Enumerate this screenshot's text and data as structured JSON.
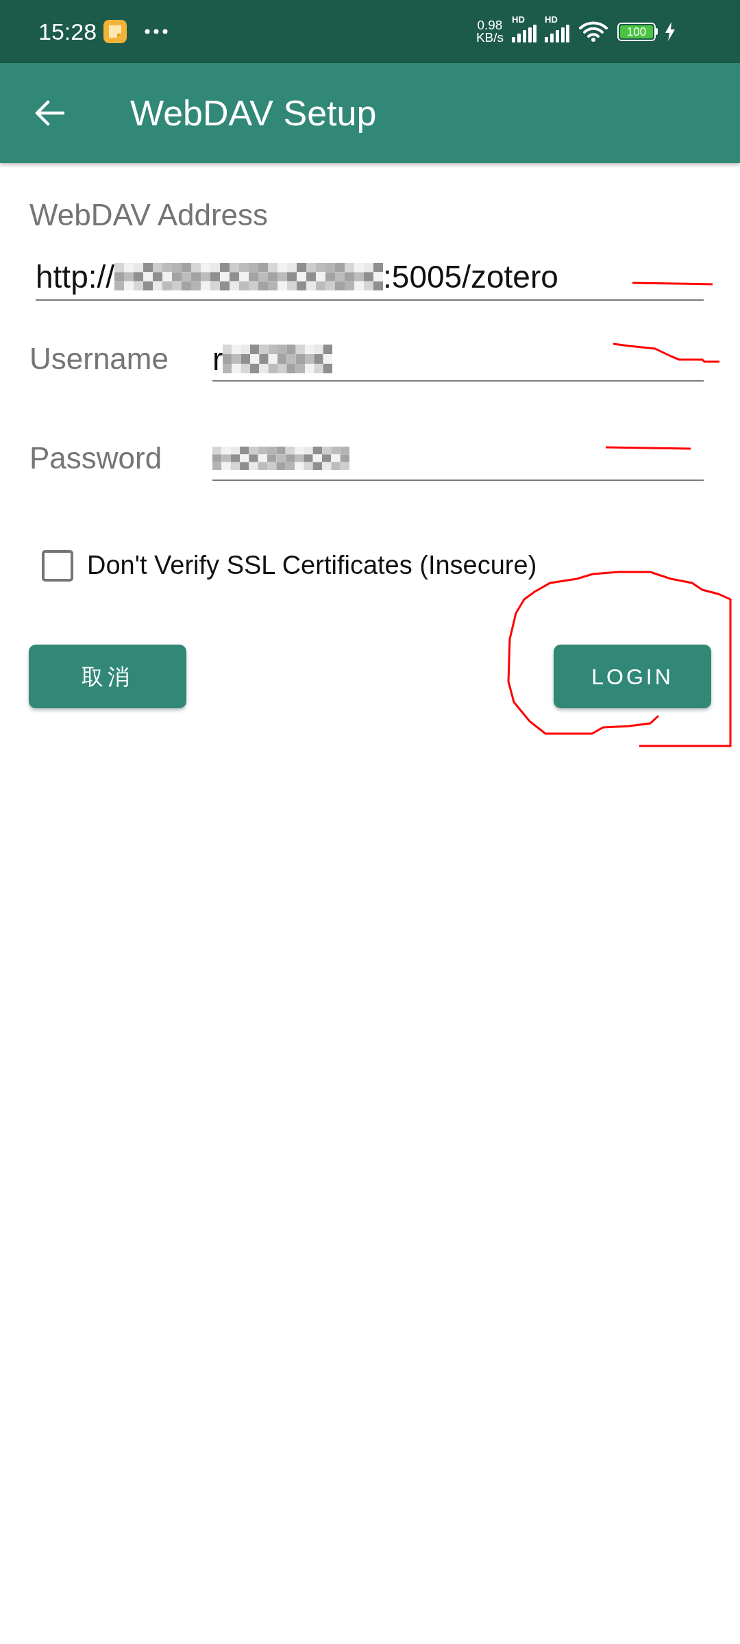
{
  "status_bar": {
    "time": "15:28",
    "network_speed": "0.98",
    "network_unit": "KB/s",
    "signals": [
      {
        "label": "HD"
      },
      {
        "label": "HD"
      }
    ],
    "battery": "100",
    "charging": true
  },
  "app_bar": {
    "title": "WebDAV Setup"
  },
  "fields": [
    {
      "kind": "stacked",
      "label": "WebDAV Address",
      "value": "http://",
      "redacted": true,
      "value_after": ":5005/zotero"
    },
    {
      "kind": "inline",
      "label": "Username",
      "value": "r",
      "redacted": true
    },
    {
      "kind": "inline",
      "label": "Password",
      "redacted": true
    }
  ],
  "checkbox": {
    "label": "Don't Verify SSL Certificates (Insecure)",
    "checked": false
  },
  "buttons": [
    {
      "kind": "cancel",
      "label": "取消"
    },
    {
      "kind": "login",
      "label": "LOGIN"
    }
  ]
}
